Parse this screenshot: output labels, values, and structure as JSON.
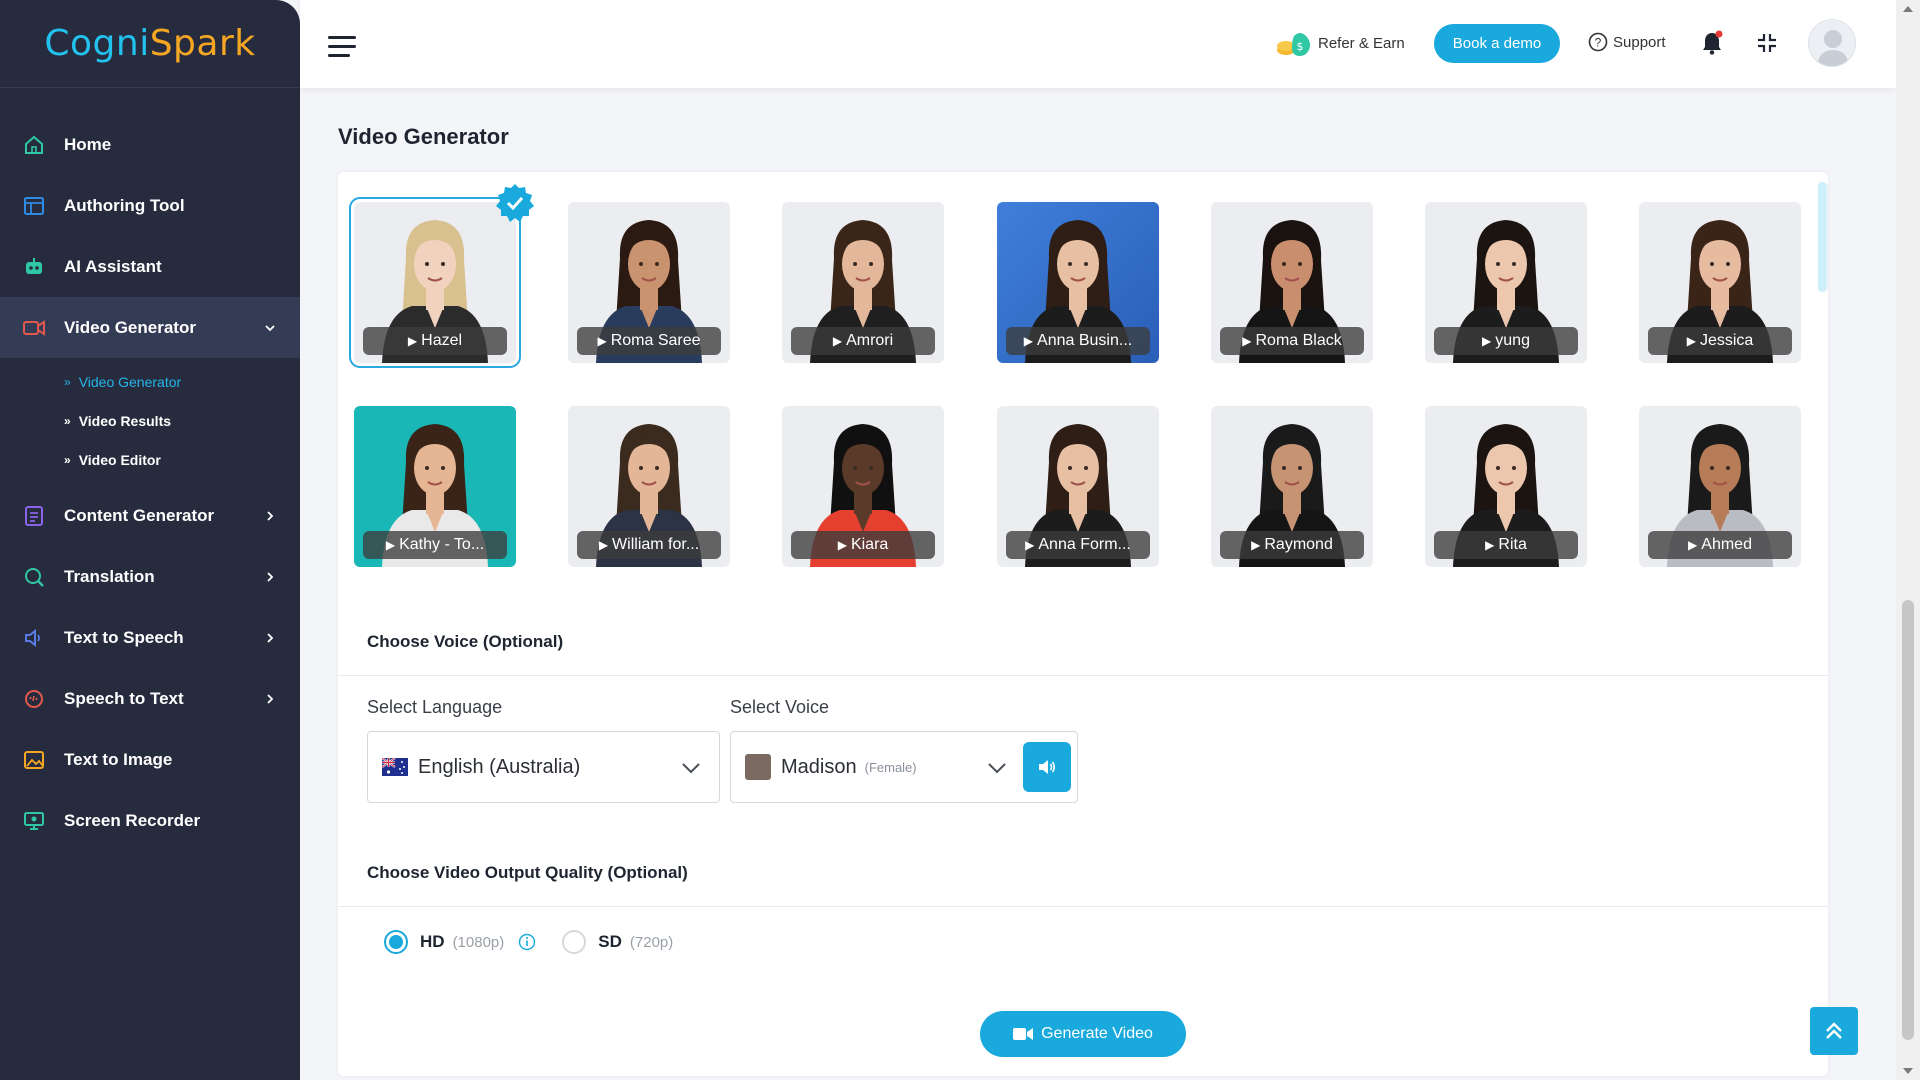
{
  "app": {
    "logo_part1": "Cogni",
    "logo_part2": "Spark"
  },
  "sidebar": {
    "items": [
      {
        "label": "Home",
        "icon": "home-icon",
        "color": "#2fc7a4"
      },
      {
        "label": "Authoring Tool",
        "icon": "authoring-icon",
        "color": "#2f8be6"
      },
      {
        "label": "AI Assistant",
        "icon": "ai-assistant-icon",
        "color": "#2fc7a4"
      },
      {
        "label": "Video Generator",
        "icon": "video-icon",
        "color": "#e2584c",
        "active": true,
        "expanded": true
      },
      {
        "label": "Content Generator",
        "icon": "content-icon",
        "color": "#8a63e6"
      },
      {
        "label": "Translation",
        "icon": "translation-icon",
        "color": "#2fc7a4"
      },
      {
        "label": "Text to Speech",
        "icon": "tts-icon",
        "color": "#5b7ce6"
      },
      {
        "label": "Speech to Text",
        "icon": "stt-icon",
        "color": "#e2584c"
      },
      {
        "label": "Text to Image",
        "icon": "image-icon",
        "color": "#f5a623"
      },
      {
        "label": "Screen Recorder",
        "icon": "recorder-icon",
        "color": "#2fc7a4"
      }
    ],
    "subitems": [
      "Video Generator",
      "Video Results",
      "Video Editor"
    ]
  },
  "topbar": {
    "refer_label": "Refer & Earn",
    "demo_label": "Book a demo",
    "support_label": "Support"
  },
  "page": {
    "title": "Video Generator"
  },
  "avatars": [
    {
      "name": "Hazel",
      "selected": true,
      "hair": "#d9c08f",
      "top": "#2b2b2b",
      "skin": "#f1d2bf"
    },
    {
      "name": "Roma Saree",
      "hair": "#2a1a12",
      "top": "#2a3c5e",
      "skin": "#c9936f"
    },
    {
      "name": "Amrori",
      "hair": "#3a2618",
      "top": "#1f1f1f",
      "skin": "#e3b89a"
    },
    {
      "name": "Anna Busin...",
      "hair": "#2e1e16",
      "top": "#1c1c1c",
      "skin": "#e7bfa3",
      "bg": "blue"
    },
    {
      "name": "Roma Black",
      "hair": "#1a120e",
      "top": "#151515",
      "skin": "#c98e6d"
    },
    {
      "name": "yung",
      "hair": "#1c1410",
      "top": "#1c1c1c",
      "skin": "#ecc7ad"
    },
    {
      "name": "Jessica",
      "hair": "#3a2418",
      "top": "#1c1c1c",
      "skin": "#e7bba0"
    },
    {
      "name": "Kathy - To...",
      "hair": "#3a2418",
      "top": "#e9e9e9",
      "skin": "#e6b594",
      "bg": "teal"
    },
    {
      "name": "William for...",
      "hair": "#3b2a1e",
      "top": "#2b3344",
      "skin": "#e2b696"
    },
    {
      "name": "Kiara",
      "hair": "#101010",
      "top": "#e5402f",
      "skin": "#5a3a28"
    },
    {
      "name": "Anna Form...",
      "hair": "#2e1e16",
      "top": "#1c1c1c",
      "skin": "#e7bfa3"
    },
    {
      "name": "Raymond",
      "hair": "#1a1a1a",
      "top": "#151515",
      "skin": "#c79473"
    },
    {
      "name": "Rita",
      "hair": "#1c1410",
      "top": "#1c1c1c",
      "skin": "#ecc7ad"
    },
    {
      "name": "Ahmed",
      "hair": "#1a1a1a",
      "top": "#b9bcc2",
      "skin": "#b77b57"
    }
  ],
  "voice": {
    "section_title": "Choose Voice (Optional)",
    "language_label": "Select Language",
    "language_value": "English (Australia)",
    "voice_label": "Select Voice",
    "voice_value": "Madison",
    "voice_gender": "(Female)"
  },
  "quality": {
    "section_title": "Choose Video Output Quality (Optional)",
    "options": [
      {
        "label": "HD",
        "sub": "(1080p)",
        "selected": true
      },
      {
        "label": "SD",
        "sub": "(720p)",
        "selected": false
      }
    ]
  },
  "generate_label": "Generate Video",
  "colors": {
    "accent": "#19a9dc",
    "sidebar_bg": "#262b3e",
    "sidebar_active": "#343b55"
  }
}
